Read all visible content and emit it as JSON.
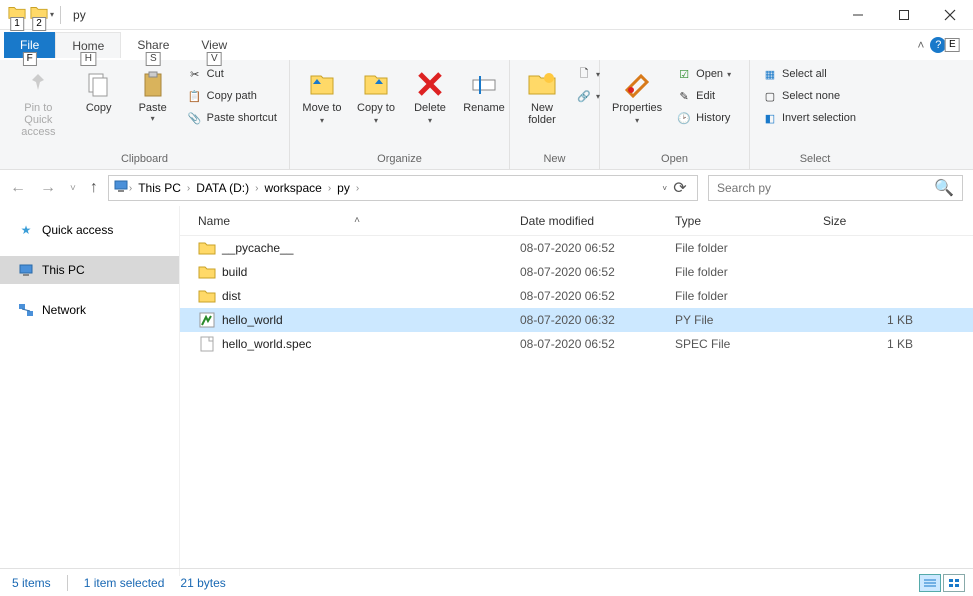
{
  "window": {
    "title": "py"
  },
  "tabs": {
    "file": "File",
    "home": "Home",
    "share": "Share",
    "view": "View"
  },
  "hints": {
    "qat1": "1",
    "qat2": "2",
    "file": "F",
    "home": "H",
    "share": "S",
    "view": "V",
    "help": "E"
  },
  "ribbon": {
    "clipboard": {
      "label": "Clipboard",
      "pin": "Pin to Quick access",
      "copy": "Copy",
      "paste": "Paste",
      "cut": "Cut",
      "copypath": "Copy path",
      "pasteshortcut": "Paste shortcut"
    },
    "organize": {
      "label": "Organize",
      "moveto": "Move to",
      "copyto": "Copy to",
      "delete": "Delete",
      "rename": "Rename"
    },
    "new": {
      "label": "New",
      "newfolder": "New folder"
    },
    "open": {
      "label": "Open",
      "properties": "Properties",
      "open": "Open",
      "edit": "Edit",
      "history": "History"
    },
    "select": {
      "label": "Select",
      "all": "Select all",
      "none": "Select none",
      "invert": "Invert selection"
    }
  },
  "breadcrumb": [
    "This PC",
    "DATA (D:)",
    "workspace",
    "py"
  ],
  "search": {
    "placeholder": "Search py"
  },
  "nav": {
    "quick": "Quick access",
    "pc": "This PC",
    "network": "Network"
  },
  "columns": {
    "name": "Name",
    "date": "Date modified",
    "type": "Type",
    "size": "Size"
  },
  "files": [
    {
      "name": "__pycache__",
      "date": "08-07-2020 06:52",
      "type": "File folder",
      "size": "",
      "icon": "folder"
    },
    {
      "name": "build",
      "date": "08-07-2020 06:52",
      "type": "File folder",
      "size": "",
      "icon": "folder"
    },
    {
      "name": "dist",
      "date": "08-07-2020 06:52",
      "type": "File folder",
      "size": "",
      "icon": "folder"
    },
    {
      "name": "hello_world",
      "date": "08-07-2020 06:32",
      "type": "PY File",
      "size": "1 KB",
      "icon": "py",
      "selected": true
    },
    {
      "name": "hello_world.spec",
      "date": "08-07-2020 06:52",
      "type": "SPEC File",
      "size": "1 KB",
      "icon": "file"
    }
  ],
  "status": {
    "count": "5 items",
    "selected": "1 item selected",
    "bytes": "21 bytes"
  }
}
